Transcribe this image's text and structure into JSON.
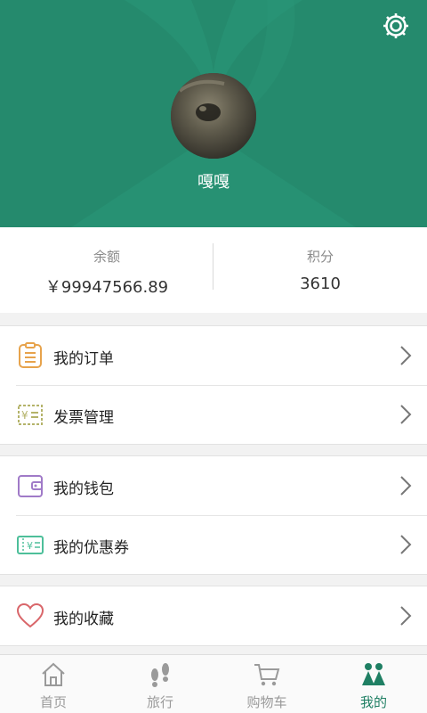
{
  "profile": {
    "username": "嘎嘎"
  },
  "stats": {
    "balance_label": "余额",
    "balance_value": "￥99947566.89",
    "points_label": "积分",
    "points_value": "3610"
  },
  "menu": {
    "group1": [
      {
        "label": "我的订单",
        "icon": "clipboard-icon",
        "color": "#e7a34c"
      },
      {
        "label": "发票管理",
        "icon": "invoice-icon",
        "color": "#b4b36a"
      }
    ],
    "group2": [
      {
        "label": "我的钱包",
        "icon": "wallet-icon",
        "color": "#a07ac8"
      },
      {
        "label": "我的优惠券",
        "icon": "coupon-icon",
        "color": "#4dbf9a"
      }
    ],
    "group3": [
      {
        "label": "我的收藏",
        "icon": "heart-icon",
        "color": "#d9666a"
      }
    ]
  },
  "tabs": [
    {
      "label": "首页",
      "icon": "home-icon",
      "active": false
    },
    {
      "label": "旅行",
      "icon": "footprints-icon",
      "active": false
    },
    {
      "label": "购物车",
      "icon": "cart-icon",
      "active": false
    },
    {
      "label": "我的",
      "icon": "profile-icon",
      "active": true
    }
  ],
  "colors": {
    "header_bg": "#258a6d",
    "accent": "#1f7f63"
  }
}
